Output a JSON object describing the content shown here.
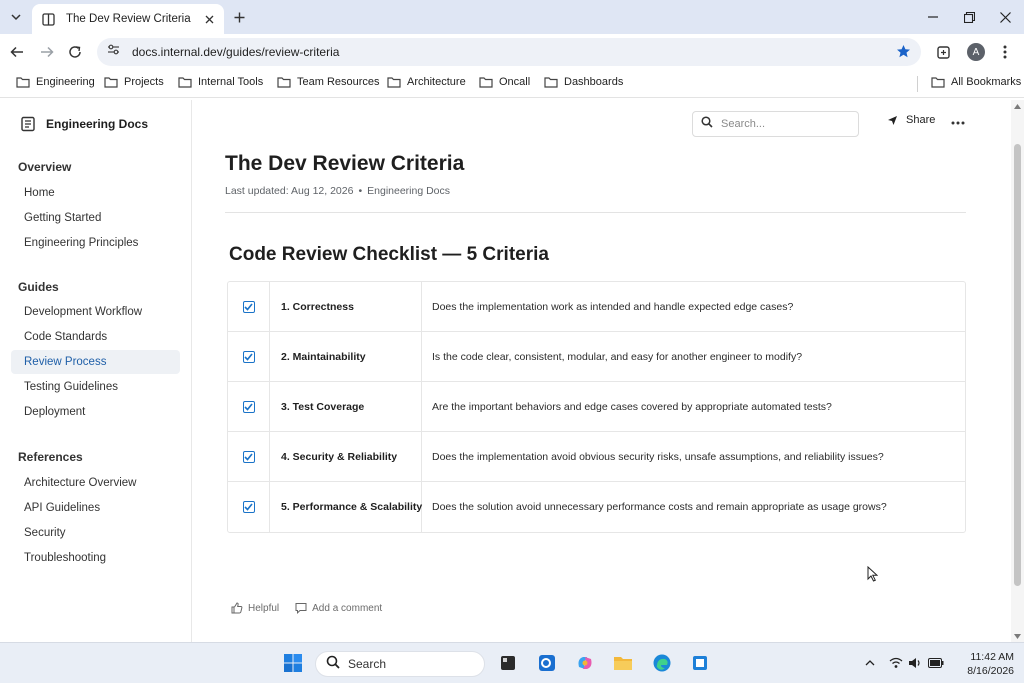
{
  "browser": {
    "tab_title": "The Dev Review Criteria",
    "url": "docs.internal.dev/guides/review-criteria",
    "profile_initial": "A",
    "bookmarks": [
      "Engineering",
      "Projects",
      "Internal Tools",
      "Team Resources",
      "Architecture",
      "Oncall",
      "Dashboards"
    ],
    "all_bookmarks": "All Bookmarks"
  },
  "sidebar": {
    "brand": "Engineering Docs",
    "sections": [
      {
        "title": "Overview",
        "items": [
          "Home",
          "Getting Started",
          "Engineering Principles"
        ]
      },
      {
        "title": "Guides",
        "items": [
          "Development Workflow",
          "Code Standards",
          "Review Process",
          "Testing Guidelines",
          "Deployment"
        ]
      },
      {
        "title": "References",
        "items": [
          "Architecture Overview",
          "API Guidelines",
          "Security",
          "Troubleshooting"
        ]
      }
    ],
    "active_item": "Review Process"
  },
  "header": {
    "search_placeholder": "Search...",
    "share_label": "Share"
  },
  "page": {
    "title": "The Dev Review Criteria",
    "last_updated": "Last updated: Aug 12, 2026",
    "separator": "•",
    "space": "Engineering Docs",
    "section_title": "Code Review Checklist — 5 Criteria",
    "criteria": [
      {
        "name": "1. Correctness",
        "description": "Does the implementation work as intended and handle expected edge cases?",
        "checked": true
      },
      {
        "name": "2. Maintainability",
        "description": "Is the code clear, consistent, modular, and easy for another engineer to modify?",
        "checked": true
      },
      {
        "name": "3. Test Coverage",
        "description": "Are the important behaviors and edge cases covered by appropriate automated tests?",
        "checked": true
      },
      {
        "name": "4. Security & Reliability",
        "description": "Does the implementation avoid obvious security risks, unsafe assumptions, and reliability issues?",
        "checked": true
      },
      {
        "name": "5. Performance & Scalability",
        "description": "Does the solution avoid unnecessary performance costs and remain appropriate as usage grows?",
        "checked": true
      }
    ],
    "feedback": {
      "helpful": "Helpful",
      "comment": "Add a comment"
    }
  },
  "taskbar": {
    "search_label": "Search",
    "time": "11:42 AM",
    "date": "8/16/2026"
  },
  "colors": {
    "accent": "#1a73c8",
    "active_nav_bg": "#eef1f5",
    "tabstrip": "#dfe6f4"
  }
}
